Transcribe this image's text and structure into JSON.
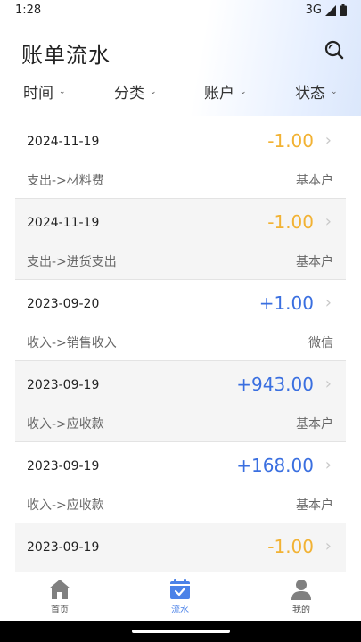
{
  "status_bar": {
    "time": "1:28",
    "network": "3G"
  },
  "header": {
    "title": "账单流水"
  },
  "filters": [
    {
      "label": "时间"
    },
    {
      "label": "分类"
    },
    {
      "label": "账户"
    },
    {
      "label": "状态"
    }
  ],
  "transactions": [
    {
      "date": "2024-11-19",
      "amount": "-1.00",
      "category": "支出->材料费",
      "account": "基本户"
    },
    {
      "date": "2024-11-19",
      "amount": "-1.00",
      "category": "支出->进货支出",
      "account": "基本户"
    },
    {
      "date": "2023-09-20",
      "amount": "+1.00",
      "category": "收入->销售收入",
      "account": "微信"
    },
    {
      "date": "2023-09-19",
      "amount": "+943.00",
      "category": "收入->应收款",
      "account": "基本户"
    },
    {
      "date": "2023-09-19",
      "amount": "+168.00",
      "category": "收入->应收款",
      "account": "基本户"
    },
    {
      "date": "2023-09-19",
      "amount": "-1.00",
      "category": "",
      "account": ""
    }
  ],
  "tabbar": [
    {
      "label": "首页",
      "icon": "home-icon"
    },
    {
      "label": "流水",
      "icon": "calendar-check-icon",
      "active": true
    },
    {
      "label": "我的",
      "icon": "person-icon"
    }
  ],
  "colors": {
    "negative": "#f2b233",
    "positive": "#3a6fe0",
    "active_tab": "#4b82e8"
  }
}
